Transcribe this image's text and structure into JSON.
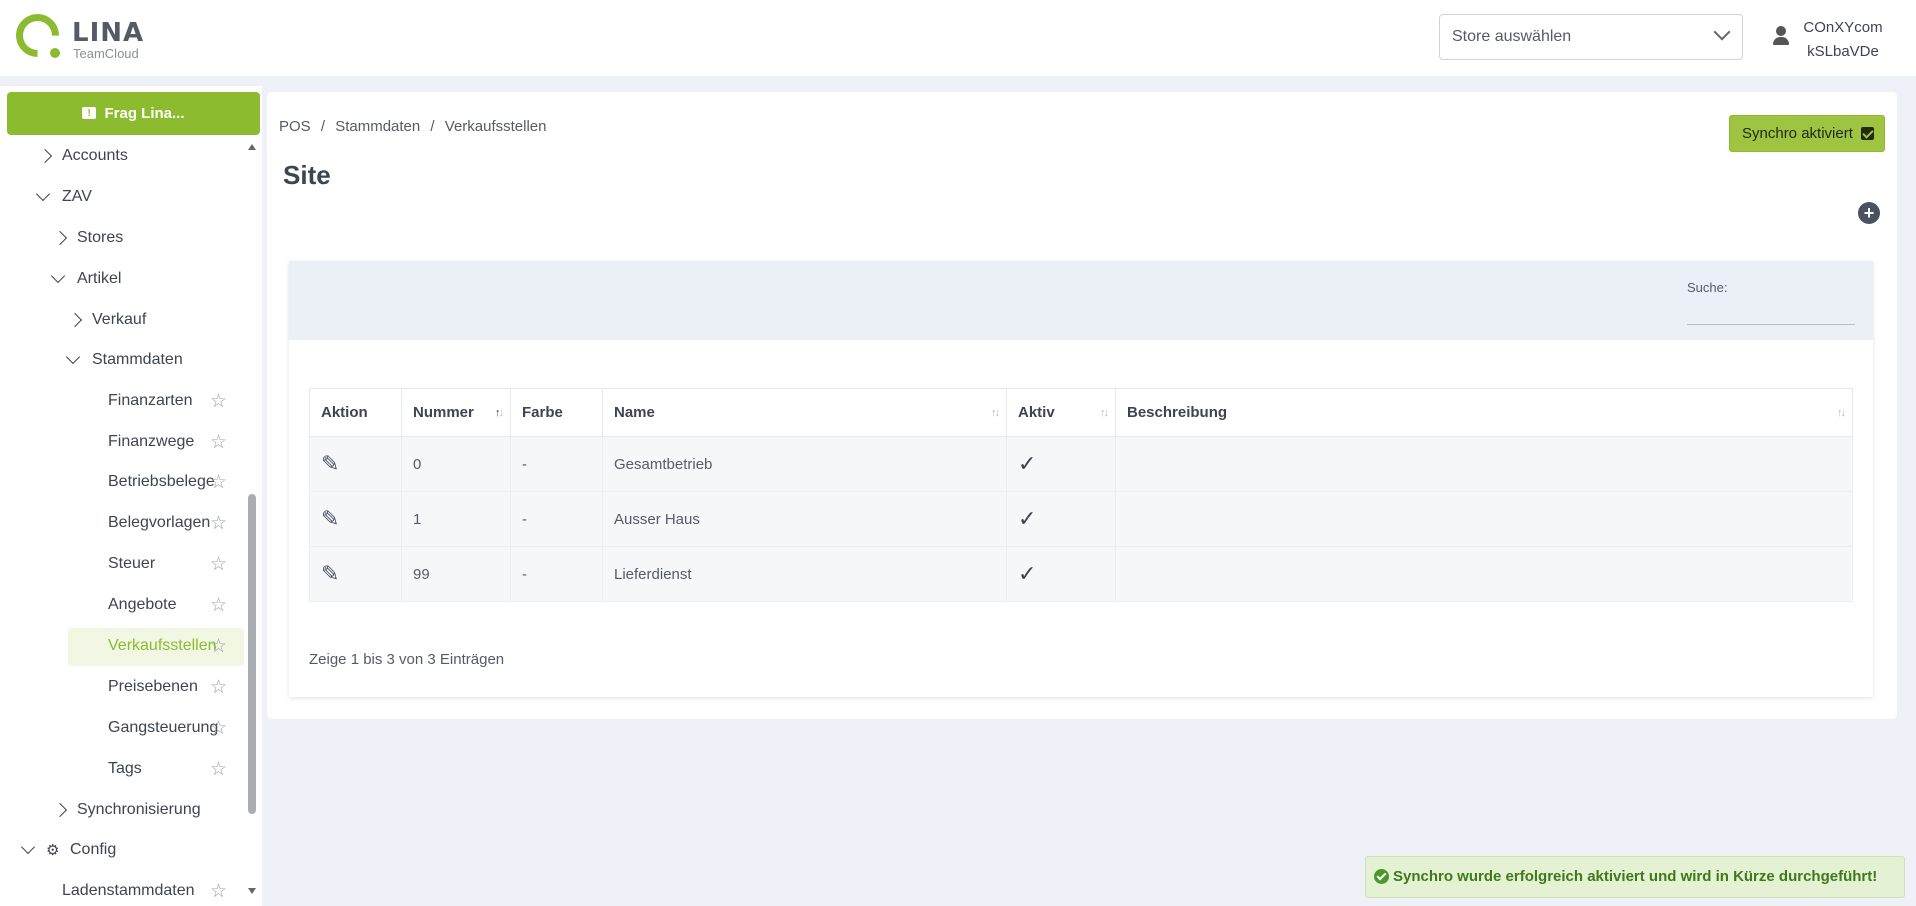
{
  "header": {
    "logo_text": "LINA",
    "logo_sub": "TeamCloud",
    "store_select_placeholder": "Store auswählen",
    "user_line1": "COnXYcom",
    "user_line2": "kSLbaVDe"
  },
  "sidebar": {
    "frag_button": "Frag Lina...",
    "items": {
      "accounts": "Accounts",
      "zav": "ZAV",
      "stores": "Stores",
      "artikel": "Artikel",
      "verkauf": "Verkauf",
      "stammdaten": "Stammdaten",
      "finanzarten": "Finanzarten",
      "finanzwege": "Finanzwege",
      "betriebsbelege": "Betriebsbelege",
      "belegvorlagen": "Belegvorlagen",
      "steuer": "Steuer",
      "angebote": "Angebote",
      "verkaufsstellen": "Verkaufsstellen",
      "preisebenen": "Preisebenen",
      "gangsteuerung": "Gangsteuerung",
      "tags": "Tags",
      "synchronisierung": "Synchronisierung",
      "config": "Config",
      "ladenstammdaten": "Ladenstammdaten"
    }
  },
  "main": {
    "breadcrumb": [
      "POS",
      "Stammdaten",
      "Verkaufsstellen"
    ],
    "breadcrumb_sep": "/",
    "title": "Site",
    "synchro_button": "Synchro aktiviert",
    "add_button": "+",
    "search_label": "Suche:",
    "search_value": "",
    "columns": [
      "Aktion",
      "Nummer",
      "Farbe",
      "Name",
      "Aktiv",
      "Beschreibung"
    ],
    "rows": [
      {
        "nummer": "0",
        "farbe": "-",
        "name": "Gesamtbetrieb",
        "aktiv": true,
        "beschreibung": ""
      },
      {
        "nummer": "1",
        "farbe": "-",
        "name": "Ausser Haus",
        "aktiv": true,
        "beschreibung": ""
      },
      {
        "nummer": "99",
        "farbe": "-",
        "name": "Lieferdienst",
        "aktiv": true,
        "beschreibung": ""
      }
    ],
    "info": "Zeige 1 bis 3 von 3 Einträgen"
  },
  "toast": {
    "message": "Synchro wurde erfolgreich aktiviert und wird in Kürze durchgeführt!"
  },
  "colors": {
    "brand": "#8dbb2f",
    "background": "#eef2f8",
    "toast_bg": "#e4f1d3",
    "toast_text": "#3f7a1a"
  }
}
